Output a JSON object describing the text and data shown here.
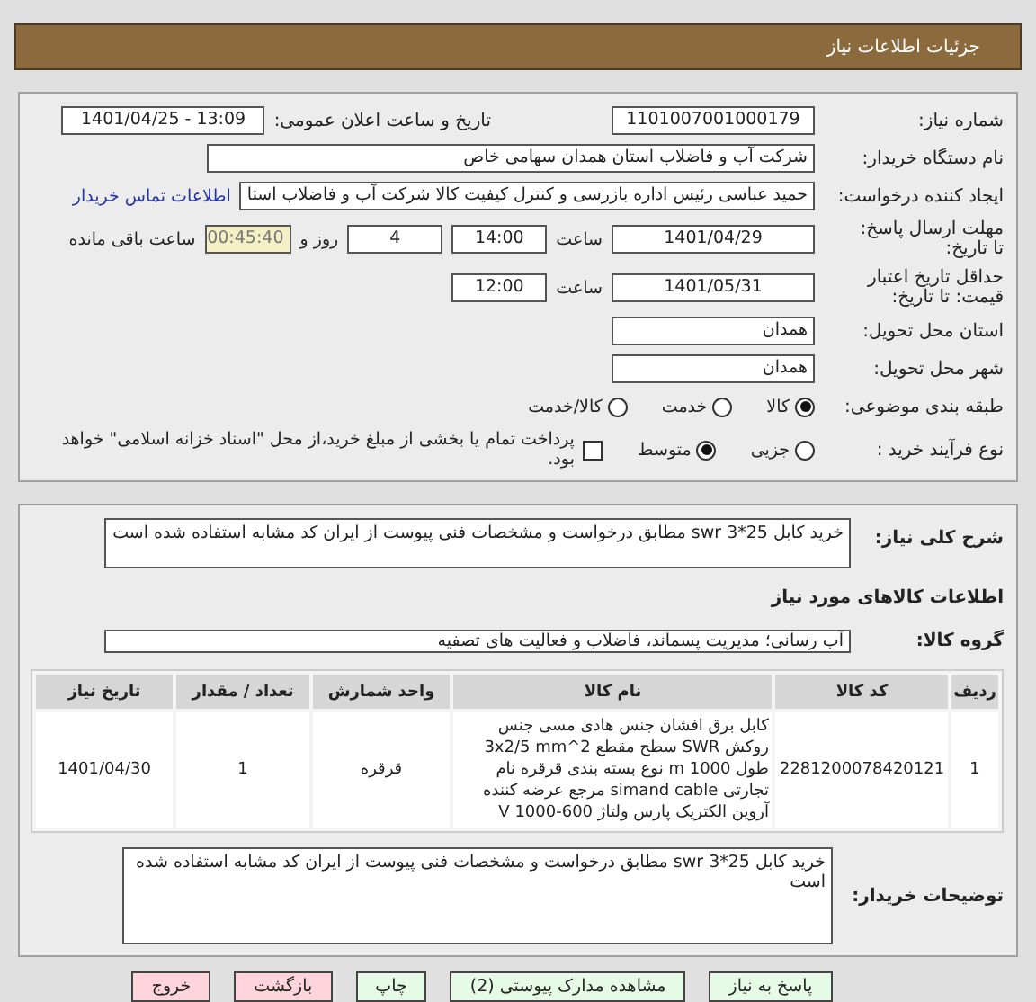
{
  "header": {
    "title": "جزئیات اطلاعات نیاز"
  },
  "details": {
    "need_number": {
      "label": "شماره نیاز:",
      "value": "1101007001000179"
    },
    "announce": {
      "label": "تاریخ و ساعت اعلان عمومی:",
      "value": "1401/04/25 - 13:09"
    },
    "buyer_org": {
      "label": "نام دستگاه خریدار:",
      "value": "شرکت آب و فاضلاب استان همدان سهامی خاص"
    },
    "requester": {
      "label": "ایجاد کننده درخواست:",
      "value": "حمید عباسی رئیس اداره بازرسی و کنترل کیفیت کالا شرکت آب و فاضلاب استا",
      "link": "اطلاعات تماس خریدار"
    },
    "reply_deadline": {
      "label": "مهلت ارسال پاسخ: تا تاریخ:",
      "date": "1401/04/29",
      "time_label": "ساعت",
      "time": "14:00",
      "days": "4",
      "days_label": "روز و",
      "remaining": "00:45:40",
      "remaining_label": "ساعت باقی مانده"
    },
    "price_validity": {
      "label": "حداقل تاریخ اعتبار قیمت: تا تاریخ:",
      "date": "1401/05/31",
      "time_label": "ساعت",
      "time": "12:00"
    },
    "province": {
      "label": "استان محل تحویل:",
      "value": "همدان"
    },
    "city": {
      "label": "شهر محل تحویل:",
      "value": "همدان"
    },
    "category": {
      "label": "طبقه بندی موضوعی:",
      "options": [
        {
          "label": "کالا",
          "selected": true
        },
        {
          "label": "خدمت",
          "selected": false
        },
        {
          "label": "کالا/خدمت",
          "selected": false
        }
      ]
    },
    "purchase_process": {
      "label": "نوع فرآیند خرید :",
      "options": [
        {
          "label": "جزیی",
          "selected": false
        },
        {
          "label": "متوسط",
          "selected": true
        }
      ],
      "payment_note": {
        "label": "پرداخت تمام یا بخشی از مبلغ خرید،از محل \"اسناد خزانه اسلامی\" خواهد بود.",
        "checked": false
      }
    }
  },
  "summary": {
    "label": "شرح کلی نیاز:",
    "value": "خرید کابل 25*3 swr مطابق درخواست و مشخصات فنی پیوست از ایران کد مشابه استفاده شده است"
  },
  "goods_heading": "اطلاعات کالاهای مورد نیاز",
  "goods_group": {
    "label": "گروه کالا:",
    "value": "آب رسانی؛ مدیریت پسماند، فاضلاب و فعالیت های تصفیه"
  },
  "table": {
    "columns": [
      "ردیف",
      "کد کالا",
      "نام کالا",
      "واحد شمارش",
      "تعداد / مقدار",
      "تاریخ نیاز"
    ],
    "rows": [
      [
        "1",
        "2281200078420121",
        "کابل برق افشان جنس هادی مسی جنس روکش SWR سطح مقطع 3x2/5 mm^2 طول 1000 m نوع بسته بندی قرقره نام تجارتی simand cable مرجع عرضه کننده آروین الکتریک پارس ولتاژ 600-1000 V",
        "قرقره",
        "1",
        "1401/04/30"
      ]
    ]
  },
  "buyer_notes": {
    "label": "توضیحات خریدار:",
    "value": "خرید کابل 25*3 swr مطابق درخواست و مشخصات فنی پیوست از ایران کد مشابه استفاده شده است"
  },
  "buttons": [
    {
      "label": "پاسخ به نیاز",
      "kind": "action"
    },
    {
      "label": "مشاهده مدارک پیوستی (2)",
      "kind": "action"
    },
    {
      "label": "چاپ",
      "kind": "action"
    },
    {
      "label": "بازگشت",
      "kind": "exit"
    },
    {
      "label": "خروج",
      "kind": "exit"
    }
  ]
}
